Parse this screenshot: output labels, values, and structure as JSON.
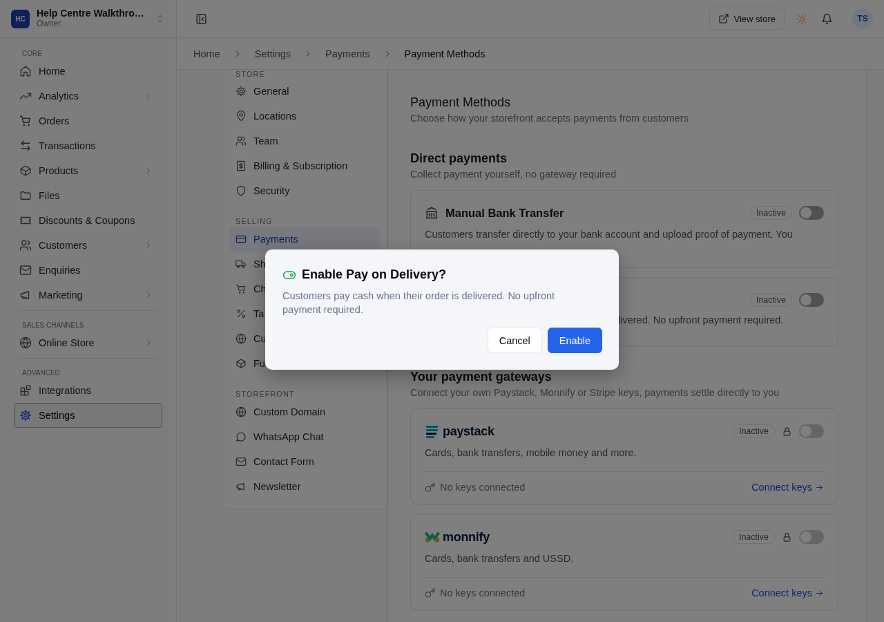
{
  "workspace": {
    "initials": "HC",
    "name": "Help Centre Walkthro…",
    "role": "Owner"
  },
  "sidebar": {
    "sections": [
      {
        "label": "CORE",
        "items": [
          {
            "label": "Home",
            "has_submenu": false,
            "selected": false
          },
          {
            "label": "Analytics",
            "has_submenu": true,
            "selected": false
          },
          {
            "label": "Orders",
            "has_submenu": false,
            "selected": false
          },
          {
            "label": "Transactions",
            "has_submenu": false,
            "selected": false
          },
          {
            "label": "Products",
            "has_submenu": true,
            "selected": false
          },
          {
            "label": "Files",
            "has_submenu": false,
            "selected": false
          },
          {
            "label": "Discounts & Coupons",
            "has_submenu": false,
            "selected": false
          },
          {
            "label": "Customers",
            "has_submenu": true,
            "selected": false
          },
          {
            "label": "Enquiries",
            "has_submenu": false,
            "selected": false
          },
          {
            "label": "Marketing",
            "has_submenu": true,
            "selected": false
          }
        ]
      },
      {
        "label": "SALES CHANNELS",
        "items": [
          {
            "label": "Online Store",
            "has_submenu": true,
            "selected": false
          }
        ]
      },
      {
        "label": "ADVANCED",
        "items": [
          {
            "label": "Integrations",
            "has_submenu": false,
            "selected": false
          },
          {
            "label": "Settings",
            "has_submenu": false,
            "selected": true
          }
        ]
      }
    ]
  },
  "topbar": {
    "view_store": "View store",
    "avatar": "TS"
  },
  "breadcrumbs": [
    "Home",
    "Settings",
    "Payments",
    "Payment Methods"
  ],
  "settings_nav": {
    "sections": [
      {
        "label": "STORE",
        "items": [
          {
            "label": "General",
            "selected": false
          },
          {
            "label": "Locations",
            "selected": false
          },
          {
            "label": "Team",
            "selected": false
          },
          {
            "label": "Billing & Subscription",
            "selected": false
          },
          {
            "label": "Security",
            "selected": false
          }
        ]
      },
      {
        "label": "SELLING",
        "items": [
          {
            "label": "Payments",
            "selected": true
          },
          {
            "label": "Sh",
            "selected": false
          },
          {
            "label": "Ch",
            "selected": false
          },
          {
            "label": "Ta",
            "selected": false
          },
          {
            "label": "Cu",
            "selected": false
          },
          {
            "label": "Fu",
            "selected": false
          }
        ]
      },
      {
        "label": "STOREFRONT",
        "items": [
          {
            "label": "Custom Domain",
            "selected": false
          },
          {
            "label": "WhatsApp Chat",
            "selected": false
          },
          {
            "label": "Contact Form",
            "selected": false
          },
          {
            "label": "Newsletter",
            "selected": false
          }
        ]
      }
    ]
  },
  "page": {
    "title": "Payment Methods",
    "subtitle": "Choose how your storefront accepts payments from customers",
    "sections": [
      {
        "title": "Direct payments",
        "subtitle": "Collect payment yourself, no gateway required",
        "cards": [
          {
            "kind": "method",
            "title": "Manual Bank Transfer",
            "description": "Customers transfer directly to your bank account and upload proof of payment. You",
            "status": "Inactive",
            "on": false,
            "disabled": false
          },
          {
            "kind": "covered",
            "description": "livered. No upfront payment required.",
            "status": "Inactive",
            "on": false,
            "disabled": false
          }
        ]
      },
      {
        "title": "Your payment gateways",
        "subtitle": "Connect your own Paystack, Monnify or Stripe keys, payments settle directly to you",
        "cards": [
          {
            "kind": "gateway",
            "title": "paystack",
            "description": "Cards, bank transfers, mobile money and more.",
            "status": "Inactive",
            "on": false,
            "disabled": true,
            "keys": "No keys connected",
            "action": "Connect keys"
          },
          {
            "kind": "gateway",
            "title": "monnify",
            "description": "Cards, bank transfers and USSD.",
            "status": "Inactive",
            "on": false,
            "disabled": true,
            "keys": "No keys connected",
            "action": "Connect keys"
          }
        ]
      }
    ]
  },
  "dialog": {
    "title": "Enable Pay on Delivery?",
    "message": "Customers pay cash when their order is delivered. No upfront payment required.",
    "buttons": [
      {
        "label": "Cancel",
        "kind": "secondary"
      },
      {
        "label": "Enable",
        "kind": "primary"
      }
    ]
  }
}
